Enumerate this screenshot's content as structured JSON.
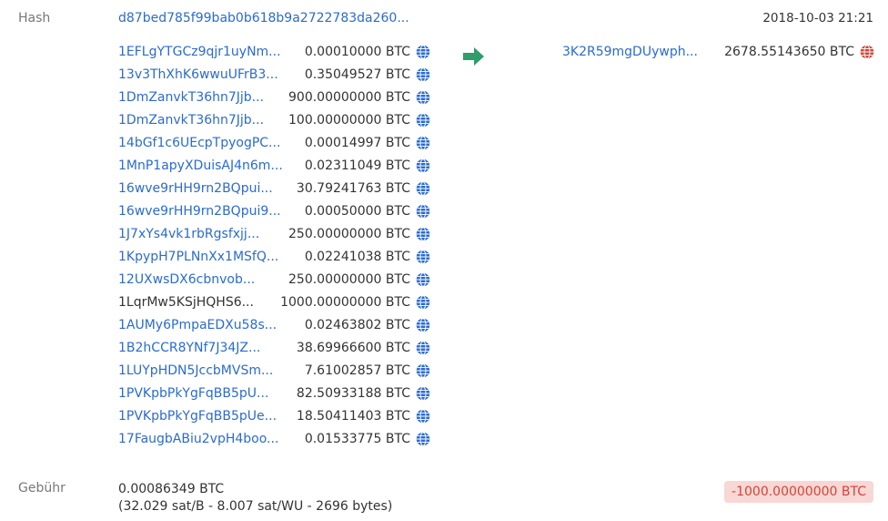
{
  "labels": {
    "hash": "Hash",
    "fee": "Gebühr"
  },
  "tx": {
    "hash": "d87bed785f99bab0b618b9a2722783da260...",
    "time": "2018-10-03 21:21"
  },
  "inputs": [
    {
      "addr": "1EFLgYTGCz9qjr1uyNm...",
      "amount": "0.00010000 BTC"
    },
    {
      "addr": "13v3ThXhK6wwuUFrB3...",
      "amount": "0.35049527 BTC"
    },
    {
      "addr": "1DmZanvkT36hn7Jjb...",
      "amount": "900.00000000 BTC"
    },
    {
      "addr": "1DmZanvkT36hn7Jjb...",
      "amount": "100.00000000 BTC"
    },
    {
      "addr": "14bGf1c6UEcpTpyogPC...",
      "amount": "0.00014997 BTC"
    },
    {
      "addr": "1MnP1apyXDuisAJ4n6m...",
      "amount": "0.02311049 BTC"
    },
    {
      "addr": "16wve9rHH9rn2BQpui...",
      "amount": "30.79241763 BTC"
    },
    {
      "addr": "16wve9rHH9rn2BQpui9...",
      "amount": "0.00050000 BTC"
    },
    {
      "addr": "1J7xYs4vk1rbRgsfxjj...",
      "amount": "250.00000000 BTC"
    },
    {
      "addr": "1KpypH7PLNnXx1MSfQ...",
      "amount": "0.02241038 BTC"
    },
    {
      "addr": "12UXwsDX6cbnvob...",
      "amount": "250.00000000 BTC"
    },
    {
      "addr": "1LqrMw5KSjHQHS6...",
      "amount": "1000.00000000 BTC",
      "plain": true
    },
    {
      "addr": "1AUMy6PmpaEDXu58s...",
      "amount": "0.02463802 BTC"
    },
    {
      "addr": "1B2hCCR8YNf7J34JZ...",
      "amount": "38.69966600 BTC"
    },
    {
      "addr": "1LUYpHDN5JccbMVSm...",
      "amount": "7.61002857 BTC"
    },
    {
      "addr": "1PVKpbPkYgFqBB5pU...",
      "amount": "82.50933188 BTC"
    },
    {
      "addr": "1PVKpbPkYgFqBB5pUe...",
      "amount": "18.50411403 BTC"
    },
    {
      "addr": "17FaugbABiu2vpH4boo...",
      "amount": "0.01533775 BTC"
    }
  ],
  "output": {
    "addr": "3K2R59mgDUywph...",
    "amount": "2678.55143650 BTC"
  },
  "fee": {
    "value": "0.00086349 BTC",
    "detail": "(32.029 sat/B - 8.007 sat/WU - 2696 bytes)"
  },
  "delta": "-1000.00000000 BTC",
  "colors": {
    "link": "#2a6bd1",
    "globe_blue": "#2a6bd1",
    "globe_red": "#d0453a",
    "arrow_green": "#2e9e6a",
    "badge_bg": "#f8d7d4",
    "badge_text": "#d0453a"
  },
  "icons": {
    "input_globe": "globe-icon",
    "output_globe": "globe-icon",
    "direction": "arrow-right-icon"
  }
}
